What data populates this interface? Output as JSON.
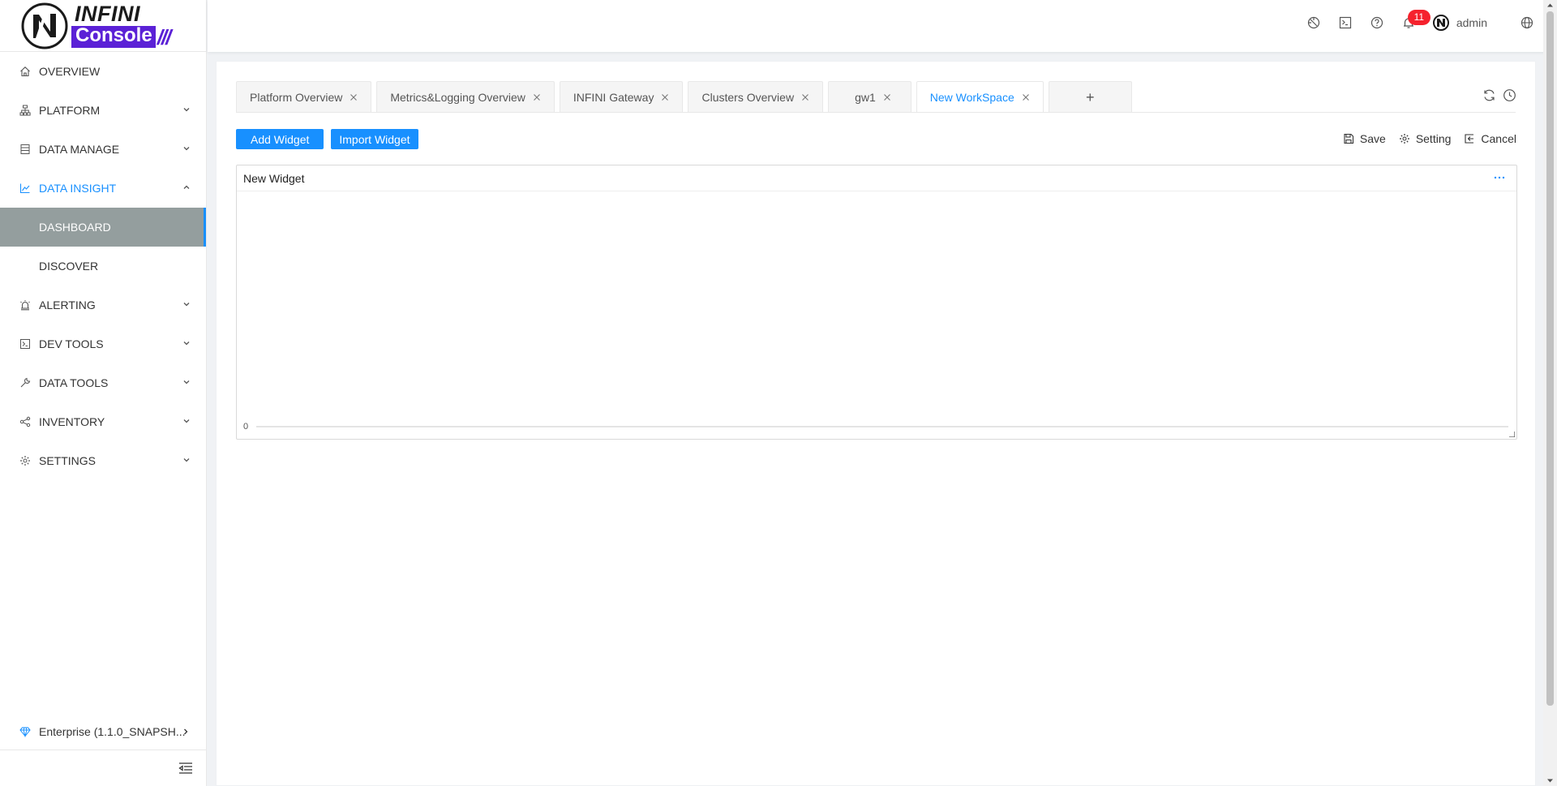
{
  "brand": {
    "top": "INFINI",
    "bottom": "Console",
    "slashes": "///",
    "accent": "#5b21d6"
  },
  "sidebar": {
    "items": [
      {
        "label": "OVERVIEW",
        "icon": "home-icon"
      },
      {
        "label": "PLATFORM",
        "icon": "sitemap-icon"
      },
      {
        "label": "DATA MANAGE",
        "icon": "database-icon"
      },
      {
        "label": "DATA INSIGHT",
        "icon": "line-chart-icon",
        "expanded": true
      },
      {
        "label": "DASHBOARD",
        "selected": true
      },
      {
        "label": "DISCOVER"
      },
      {
        "label": "ALERTING",
        "icon": "alarm-icon"
      },
      {
        "label": "DEV TOOLS",
        "icon": "terminal-icon"
      },
      {
        "label": "DATA TOOLS",
        "icon": "tool-icon"
      },
      {
        "label": "INVENTORY",
        "icon": "share-icon"
      },
      {
        "label": "SETTINGS",
        "icon": "gear-icon"
      }
    ],
    "footer": "Enterprise (1.1.0_SNAPSH..."
  },
  "header": {
    "notification_count": "11",
    "user": "admin"
  },
  "workspace_tabs": [
    {
      "label": "Platform Overview"
    },
    {
      "label": "Metrics&Logging Overview"
    },
    {
      "label": "INFINI Gateway"
    },
    {
      "label": "Clusters Overview"
    },
    {
      "label": "gw1"
    },
    {
      "label": "New WorkSpace",
      "active": true
    }
  ],
  "add_tab_label": "+",
  "actions": {
    "add_widget": "Add Widget",
    "import_widget": "Import Widget"
  },
  "editor": {
    "save": "Save",
    "setting": "Setting",
    "cancel": "Cancel"
  },
  "widget": {
    "title": "New Widget"
  },
  "chart_data": {
    "type": "line",
    "title": "",
    "series": [],
    "y_tick_labels": [
      "0"
    ],
    "ylim": [
      0,
      0
    ],
    "grid": false
  },
  "colors": {
    "primary": "#1890ff",
    "selected_bg": "#949e9e",
    "badge": "#f5222d"
  }
}
